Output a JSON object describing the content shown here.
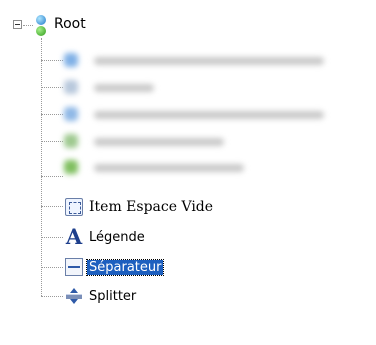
{
  "tree": {
    "root": {
      "label": "Root",
      "expanded": true,
      "icon": "root-node-icon"
    },
    "items": [
      {
        "label": "Item Espace Vide",
        "icon": "empty-space-icon",
        "selected": false
      },
      {
        "label": "Légende",
        "icon": "caption-icon",
        "selected": false
      },
      {
        "label": "Séparateur",
        "icon": "separator-icon",
        "selected": true
      },
      {
        "label": "Splitter",
        "icon": "splitter-icon",
        "selected": false
      }
    ]
  },
  "colors": {
    "selection": "#1d5fbf",
    "tree_lines": "#9a9a9a"
  }
}
